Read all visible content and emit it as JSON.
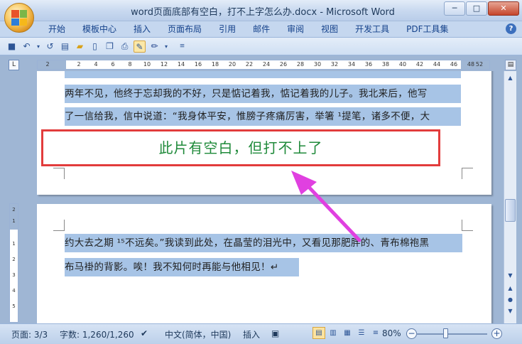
{
  "window": {
    "title": "word页面底部有空白，打不上字怎么办.docx - Microsoft Word",
    "minimize": "─",
    "maximize": "□",
    "close": "✕"
  },
  "quick_access": [
    "💾",
    "↶",
    "↺"
  ],
  "ribbon": {
    "tabs": [
      "开始",
      "模板中心",
      "插入",
      "页面布局",
      "引用",
      "邮件",
      "审阅",
      "视图",
      "开发工具",
      "PDF工具集"
    ],
    "help": "?"
  },
  "ruler": {
    "corner": "L",
    "ticks": [
      "2",
      "2",
      "4",
      "6",
      "8",
      "10",
      "12",
      "14",
      "16",
      "18",
      "20",
      "22",
      "24",
      "26",
      "28",
      "30",
      "32",
      "34",
      "36",
      "38",
      "40",
      "42",
      "44",
      "46",
      "48",
      "52"
    ],
    "vticks": [
      "2",
      "1",
      "1",
      "2",
      "3",
      "4",
      "5"
    ]
  },
  "document": {
    "page1_lines": [
      "两年不见，他终于忘却我的不好，只是惦记着我，惦记着我的儿子。我北来后，他写",
      "了一信给我，信中说道：“我身体平安，惟膀子疼痛厉害，举箸 ¹提笔，诸多不便，大"
    ],
    "page2_lines": [
      "约大去之期 ¹⁵不远矣。”我读到此处，在晶莹的泪光中，又看见那肥胖的、青布棉袍黑",
      "布马褂的背影。唉！我不知何时再能与他相见！↵"
    ]
  },
  "annotation": {
    "callout_text": "此片有空白，但打不上了",
    "box_color": "#e23c3c",
    "arrow_color": "#e040e0",
    "text_color": "#1f8a3a"
  },
  "statusbar": {
    "page": "页面: 3/3",
    "words": "字数: 1,260/1,260",
    "language": "中文(简体，中国)",
    "mode": "插入",
    "zoom": "80%",
    "zoom_out": "−",
    "zoom_in": "+"
  }
}
